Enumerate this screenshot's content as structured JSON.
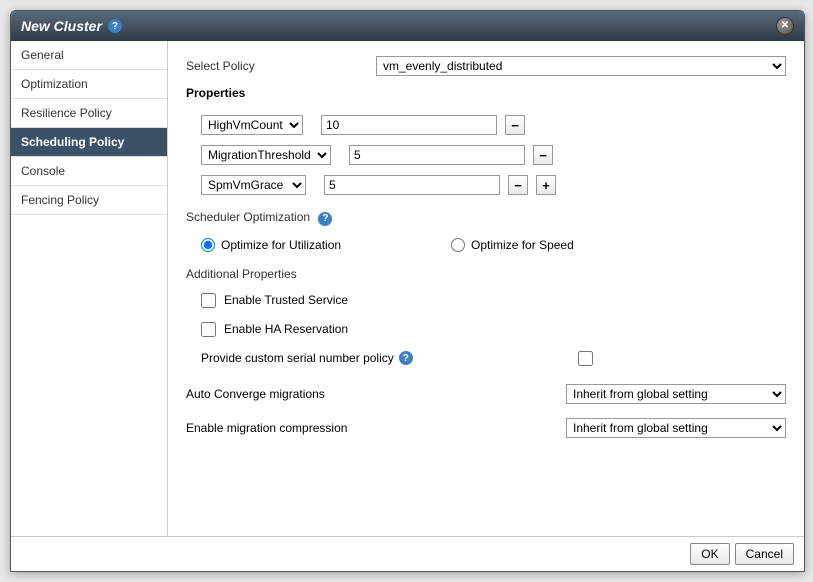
{
  "dialog": {
    "title": "New Cluster",
    "ok_label": "OK",
    "cancel_label": "Cancel"
  },
  "sidebar": {
    "items": [
      {
        "label": "General"
      },
      {
        "label": "Optimization"
      },
      {
        "label": "Resilience Policy"
      },
      {
        "label": "Scheduling Policy"
      },
      {
        "label": "Console"
      },
      {
        "label": "Fencing Policy"
      }
    ]
  },
  "form": {
    "select_policy_label": "Select Policy",
    "select_policy_value": "vm_evenly_distributed",
    "properties_label": "Properties",
    "props": [
      {
        "name": "HighVmCount",
        "value": "10",
        "input_width": "176",
        "remove_only": true
      },
      {
        "name": "MigrationThreshold",
        "value": "5",
        "input_width": "176",
        "remove_only": true
      },
      {
        "name": "SpmVmGrace",
        "value": "5",
        "input_width": "176",
        "remove_only": false
      }
    ],
    "scheduler_opt_label": "Scheduler Optimization",
    "opt_utilization_label": "Optimize for Utilization",
    "opt_speed_label": "Optimize for Speed",
    "additional_props_label": "Additional Properties",
    "enable_trusted_label": "Enable Trusted Service",
    "enable_ha_label": "Enable HA Reservation",
    "custom_serial_label": "Provide custom serial number policy",
    "auto_converge_label": "Auto Converge migrations",
    "auto_converge_value": "Inherit from global setting",
    "migration_compression_label": "Enable migration compression",
    "migration_compression_value": "Inherit from global setting"
  }
}
